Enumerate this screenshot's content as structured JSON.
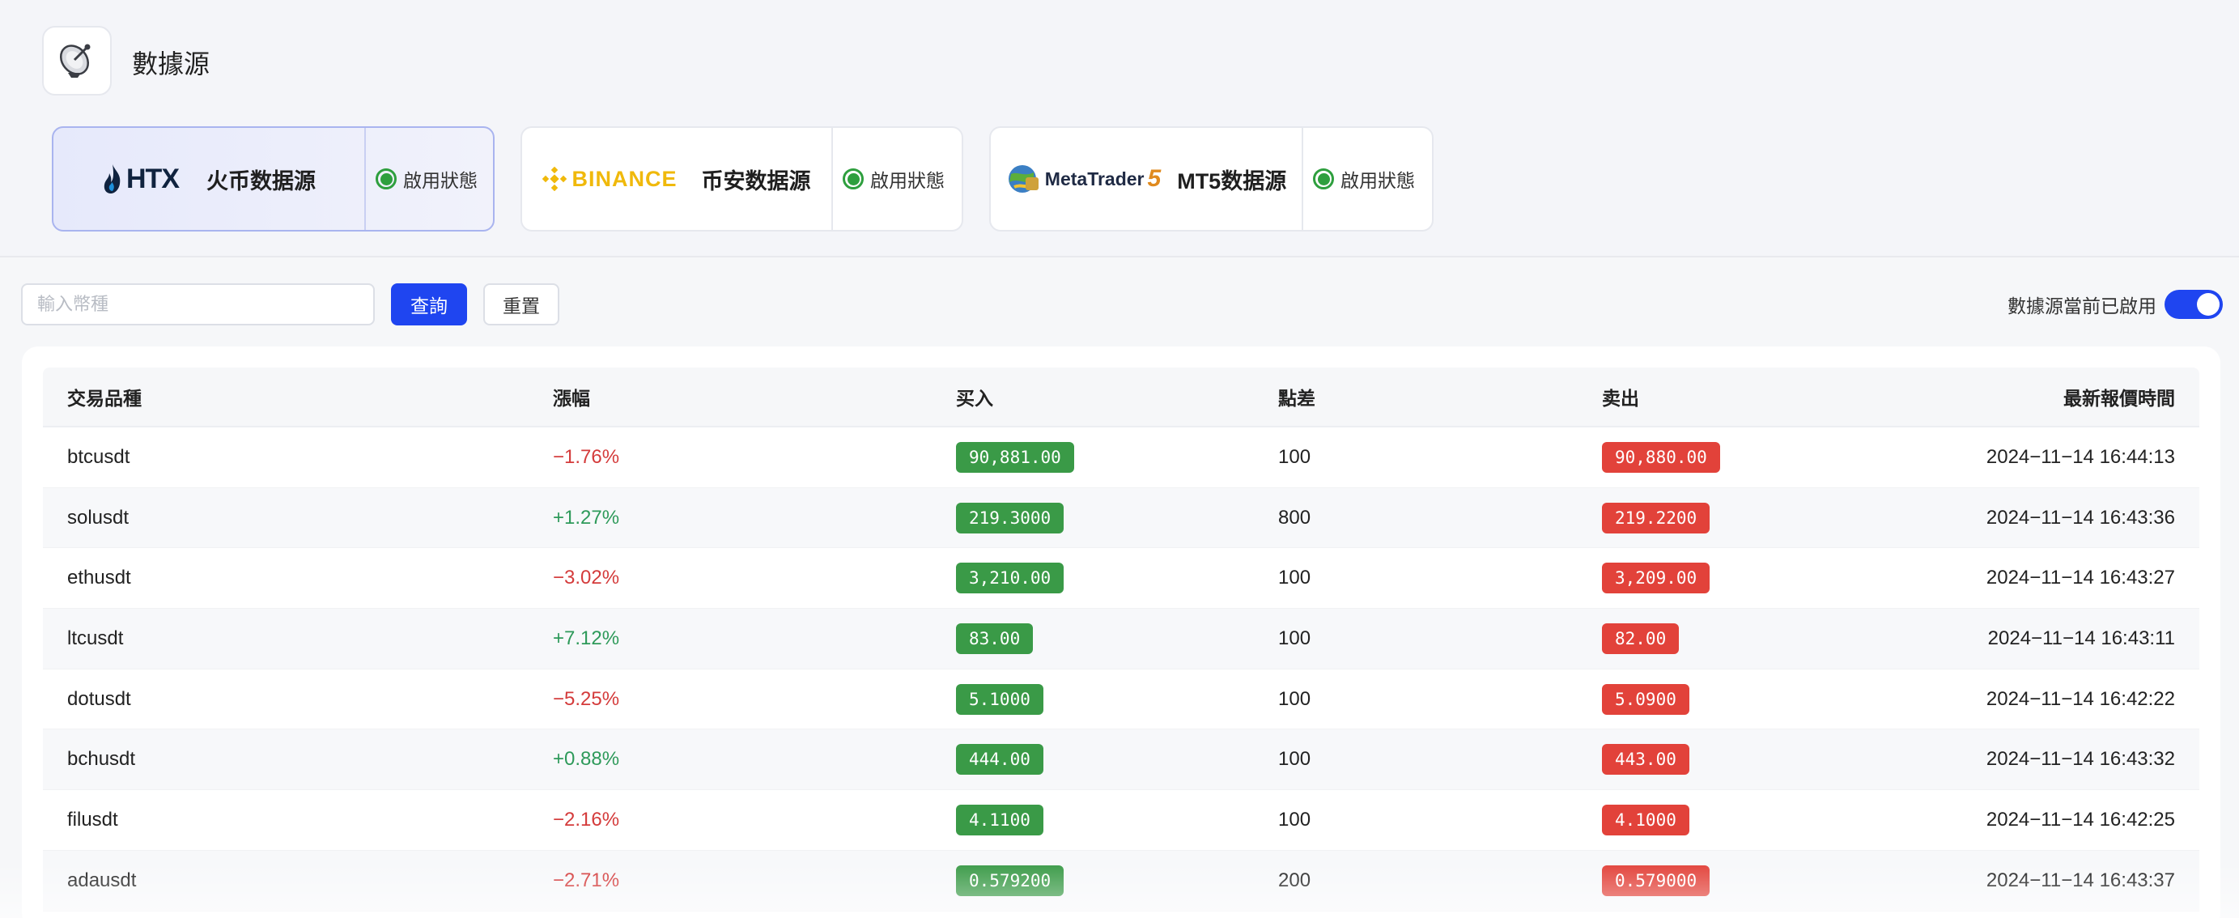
{
  "page": {
    "title": "數據源"
  },
  "sources": [
    {
      "logo_text": "HTX",
      "name": "火币数据源",
      "status": "啟用狀態",
      "active": true
    },
    {
      "logo_text": "BINANCE",
      "name": "币安数据源",
      "status": "啟用狀態",
      "active": false
    },
    {
      "logo_text": "MetaTrader",
      "logo_suffix": "5",
      "name": "MT5数据源",
      "status": "啟用狀態",
      "active": false
    }
  ],
  "filter": {
    "placeholder": "輸入幣種",
    "query_label": "查詢",
    "reset_label": "重置",
    "toggle_label": "數據源當前已啟用",
    "toggle_on": true
  },
  "table": {
    "headers": [
      "交易品種",
      "漲幅",
      "买入",
      "點差",
      "卖出",
      "最新報價時間"
    ],
    "rows": [
      {
        "symbol": "btcusdt",
        "change": "−1.76%",
        "dir": "down",
        "buy": "90,881.00",
        "spread": "100",
        "sell": "90,880.00",
        "time": "2024−11−14 16:44:13"
      },
      {
        "symbol": "solusdt",
        "change": "+1.27%",
        "dir": "up",
        "buy": "219.3000",
        "spread": "800",
        "sell": "219.2200",
        "time": "2024−11−14 16:43:36"
      },
      {
        "symbol": "ethusdt",
        "change": "−3.02%",
        "dir": "down",
        "buy": "3,210.00",
        "spread": "100",
        "sell": "3,209.00",
        "time": "2024−11−14 16:43:27"
      },
      {
        "symbol": "ltcusdt",
        "change": "+7.12%",
        "dir": "up",
        "buy": "83.00",
        "spread": "100",
        "sell": "82.00",
        "time": "2024−11−14 16:43:11"
      },
      {
        "symbol": "dotusdt",
        "change": "−5.25%",
        "dir": "down",
        "buy": "5.1000",
        "spread": "100",
        "sell": "5.0900",
        "time": "2024−11−14 16:42:22"
      },
      {
        "symbol": "bchusdt",
        "change": "+0.88%",
        "dir": "up",
        "buy": "444.00",
        "spread": "100",
        "sell": "443.00",
        "time": "2024−11−14 16:43:32"
      },
      {
        "symbol": "filusdt",
        "change": "−2.16%",
        "dir": "down",
        "buy": "4.1100",
        "spread": "100",
        "sell": "4.1000",
        "time": "2024−11−14 16:42:25"
      },
      {
        "symbol": "adausdt",
        "change": "−2.71%",
        "dir": "down",
        "buy": "0.579200",
        "spread": "200",
        "sell": "0.579000",
        "time": "2024−11−14 16:43:37"
      }
    ]
  },
  "icons": {
    "app": "satellite-dish-icon",
    "status": "radio-on-icon"
  },
  "colors": {
    "primary": "#1f45f0",
    "buy": "#3a9a47",
    "sell": "#e2423a",
    "up": "#2e9a5a",
    "down": "#d43b3b",
    "status": "#2e9f3e"
  }
}
